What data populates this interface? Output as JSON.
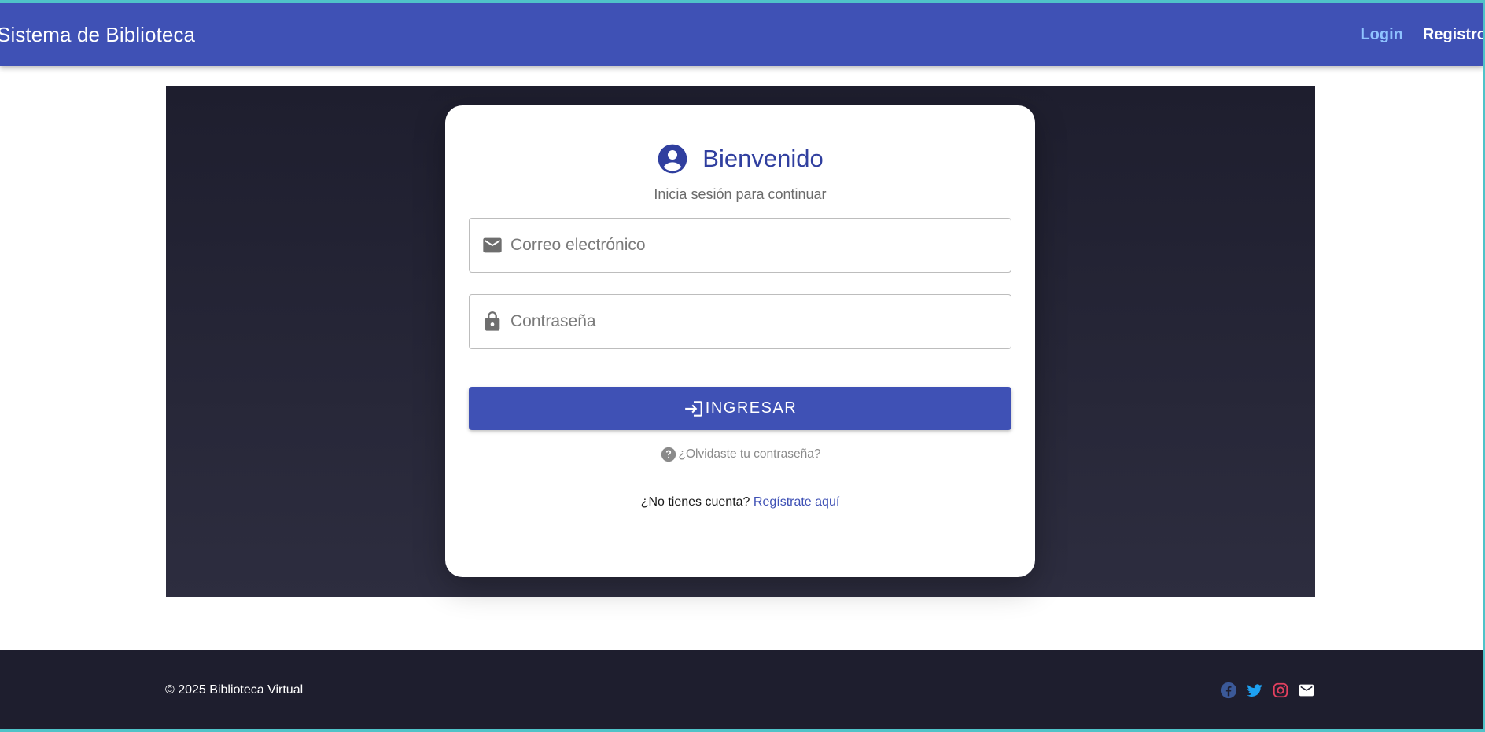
{
  "header": {
    "brand": "Sistema de Biblioteca",
    "nav": {
      "login": "Login",
      "register": "Registro"
    }
  },
  "login_card": {
    "title": "Bienvenido",
    "subtitle": "Inicia sesión para continuar",
    "email_placeholder": "Correo electrónico",
    "password_placeholder": "Contraseña",
    "submit_label": "INGRESAR",
    "forgot_label": "¿Olvidaste tu contraseña?",
    "no_account_text": "¿No tienes cuenta?",
    "register_link": "Regístrate aquí"
  },
  "footer": {
    "copyright": "© 2025 Biblioteca Virtual",
    "socials": [
      "facebook-icon",
      "twitter-icon",
      "instagram-icon",
      "email-icon"
    ]
  },
  "colors": {
    "primary": "#3f51b5",
    "title": "#303f9f",
    "hero_dark": "#1e1e2e",
    "accent_border": "#4fc3c8",
    "facebook": "#3b5998",
    "twitter": "#1da1f2",
    "instagram": "#e4405f"
  }
}
